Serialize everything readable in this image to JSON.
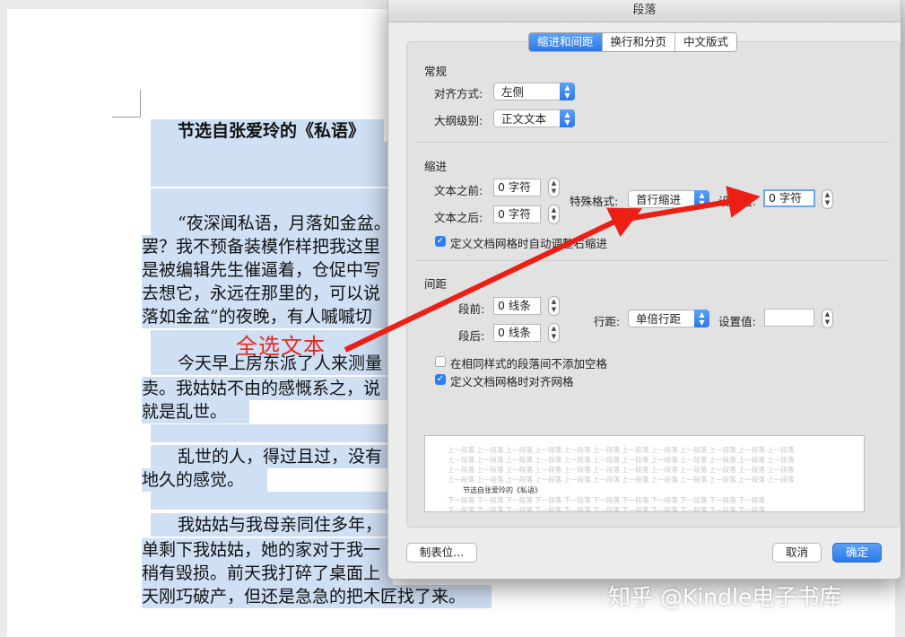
{
  "document": {
    "lines": [
      "节选自张爱玲的《私语》",
      "“夜深闻私语，月落如金盆。",
      "罢？我不预备装模作样把我这里",
      "是被编辑先生催逼着，仓促中写",
      "去想它，永远在那里的，可以说",
      "落如金盆”的夜晚，有人嘁嘁切",
      "今天早上房东派了人来测量",
      "卖。我姑姑不由的感慨系之，说",
      "就是乱世。",
      "乱世的人，得过且过，没有",
      "地久的感觉。",
      "我姑姑与我母亲同住多年，",
      "单剩下我姑姑，她的家对于我一",
      "稍有毁损。前天我打碎了桌面上",
      "天刚巧破产，但还是急急的把木匠找了来。"
    ]
  },
  "annotation": {
    "text": "全选文本"
  },
  "watermark": "知乎 @Kindle电子书库",
  "dialog": {
    "title": "段落",
    "tabs": [
      {
        "label": "缩进和间距",
        "active": true
      },
      {
        "label": "换行和分页",
        "active": false
      },
      {
        "label": "中文版式",
        "active": false
      }
    ],
    "general": {
      "title": "常规",
      "alignment_label": "对齐方式:",
      "alignment_value": "左侧",
      "outline_label": "大纲级别:",
      "outline_value": "正文文本"
    },
    "indent": {
      "title": "缩进",
      "before_label": "文本之前:",
      "before_value": "0 字符",
      "after_label": "文本之后:",
      "after_value": "0 字符",
      "special_label": "特殊格式:",
      "special_value": "首行缩进",
      "value_label": "设置值:",
      "value_value": "0 字符",
      "grid_checkbox_label": "定义文档网格时自动调整右缩进",
      "grid_checked": true
    },
    "spacing": {
      "title": "间距",
      "before_label": "段前:",
      "before_value": "0 线条",
      "after_label": "段后:",
      "after_value": "0 线条",
      "line_spacing_label": "行距:",
      "line_spacing_value": "单倍行距",
      "set_value_label": "设置值:",
      "set_value_value": "",
      "no_space_label": "在相同样式的段落间不添加空格",
      "no_space_checked": false,
      "snap_label": "定义文档网格时对齐网格",
      "snap_checked": true
    },
    "preview": {
      "filler": "上一段落 上一段落 上一段落 上一段落 上一段落 上一段落 上一段落 上一段落 上一段落 上一段落 上一段落 上一段落",
      "sample": "节选自张爱玲的《私语》",
      "next_filler": "下一段落 下一段落 下一段落 下一段落 下一段落 下一段落 下一段落 下一段落 下一段落 下一段落 下一段落"
    },
    "buttons": {
      "tabs": "制表位...",
      "cancel": "取消",
      "ok": "确定"
    }
  },
  "colors": {
    "accent": "#2c78e6",
    "selection": "#cfdff4",
    "annotation_red": "#e52a21"
  }
}
